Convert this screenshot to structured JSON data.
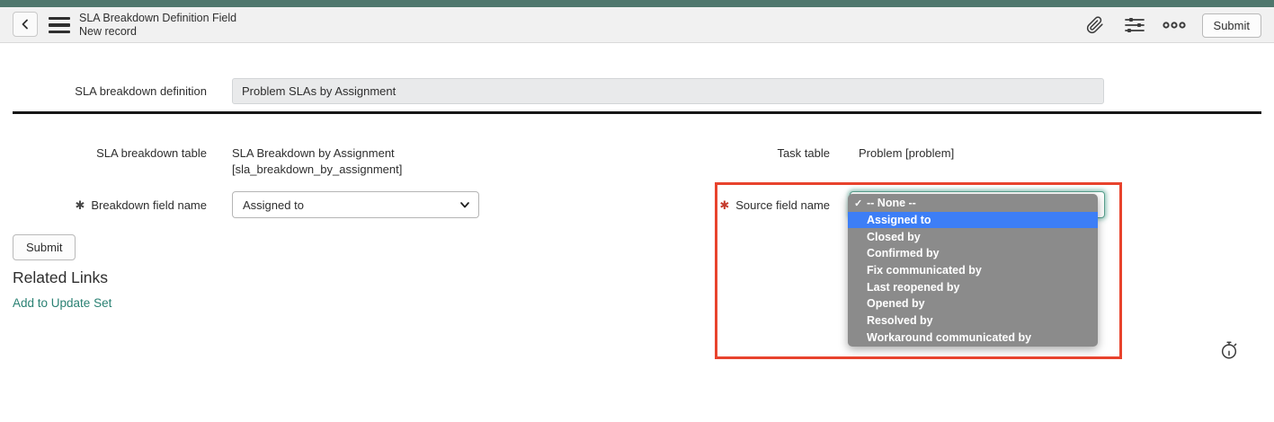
{
  "header": {
    "title": "SLA Breakdown Definition Field",
    "subtitle": "New record",
    "submit_label": "Submit"
  },
  "icons": {
    "checkmark": "✓",
    "required_marker": "✱"
  },
  "form": {
    "sla_breakdown_definition": {
      "label": "SLA breakdown definition",
      "value": "Problem SLAs by Assignment"
    },
    "sla_breakdown_table": {
      "label": "SLA breakdown table",
      "value_line1": "SLA Breakdown by Assignment",
      "value_line2": "[sla_breakdown_by_assignment]"
    },
    "task_table": {
      "label": "Task table",
      "value": "Problem [problem]"
    },
    "breakdown_field_name": {
      "label": "Breakdown field name",
      "required": true,
      "value": "Assigned to"
    },
    "source_field_name": {
      "label": "Source field name",
      "required": true,
      "dropdown": {
        "options": [
          {
            "label": "-- None --",
            "checked": true,
            "highlighted": false
          },
          {
            "label": "Assigned to",
            "checked": false,
            "highlighted": true
          },
          {
            "label": "Closed by",
            "checked": false,
            "highlighted": false
          },
          {
            "label": "Confirmed by",
            "checked": false,
            "highlighted": false
          },
          {
            "label": "Fix communicated by",
            "checked": false,
            "highlighted": false
          },
          {
            "label": "Last reopened by",
            "checked": false,
            "highlighted": false
          },
          {
            "label": "Opened by",
            "checked": false,
            "highlighted": false
          },
          {
            "label": "Resolved by",
            "checked": false,
            "highlighted": false
          },
          {
            "label": "Workaround communicated by",
            "checked": false,
            "highlighted": false
          }
        ]
      }
    }
  },
  "footer": {
    "submit_label": "Submit",
    "related_links_title": "Related Links",
    "update_set_link": "Add to Update Set"
  },
  "colors": {
    "brand-teal": "#4f776d",
    "link-teal": "#2a8173",
    "highlight-blue": "#3d7ef6",
    "alert-red": "#e8432d",
    "required-red": "#c53c2e",
    "dropdown-gray": "#8b8b8b"
  }
}
